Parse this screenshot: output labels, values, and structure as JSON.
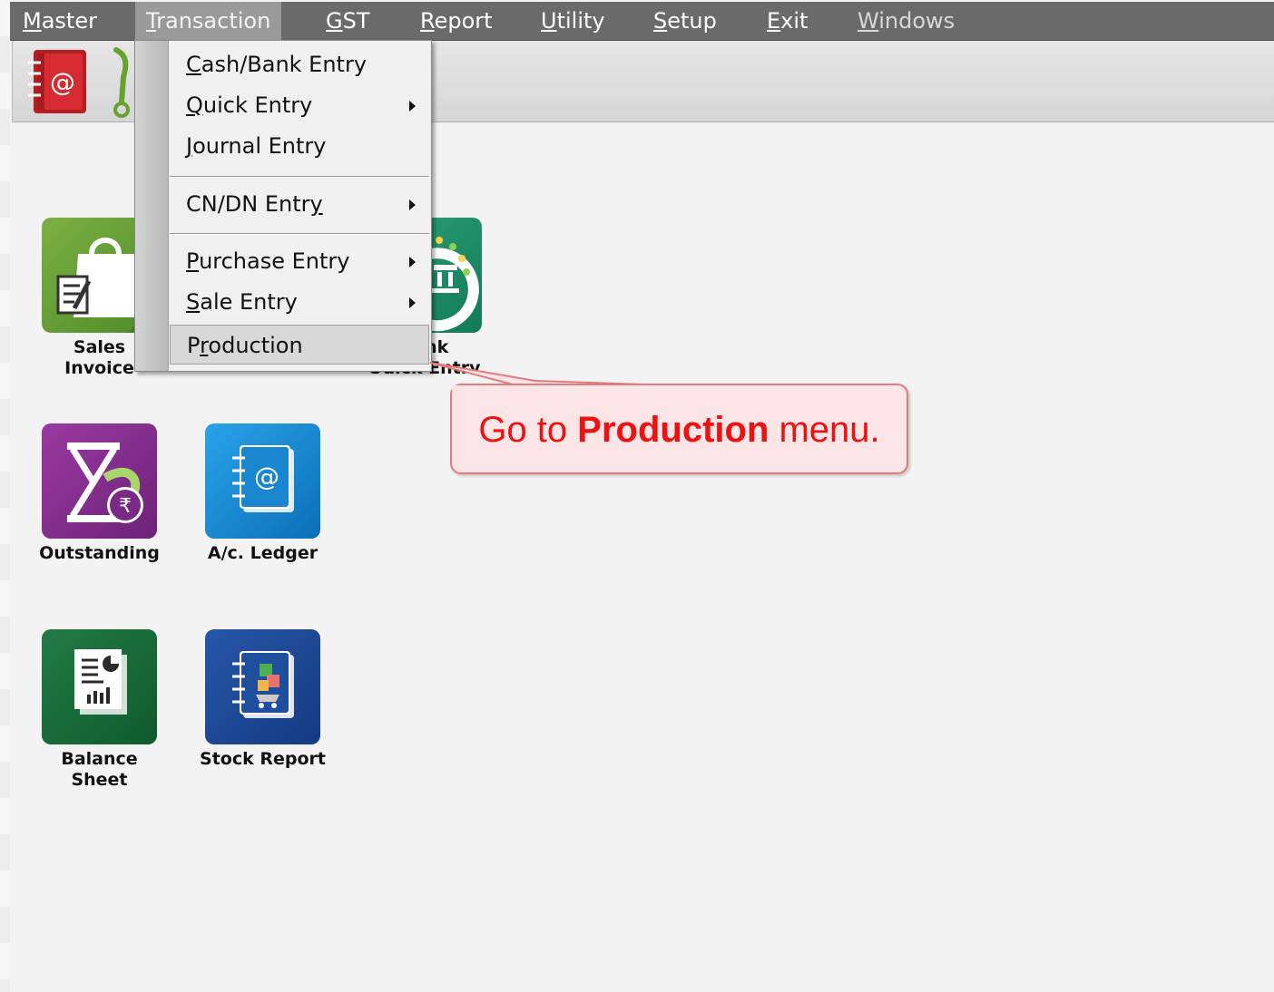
{
  "menubar": {
    "items": [
      {
        "label": "Master",
        "u": "M",
        "rest": "aster"
      },
      {
        "label": "Transaction",
        "u": "T",
        "rest": "ransaction"
      },
      {
        "label": "GST",
        "u": "G",
        "rest": "ST"
      },
      {
        "label": "Report",
        "u": "R",
        "rest": "eport"
      },
      {
        "label": "Utility",
        "u": "U",
        "rest": "tility"
      },
      {
        "label": "Setup",
        "u": "S",
        "rest": "etup"
      },
      {
        "label": "Exit",
        "u": "E",
        "rest": "xit"
      },
      {
        "label": "Windows",
        "u": "W",
        "rest": "indows"
      }
    ],
    "active": "Transaction"
  },
  "dropdown": {
    "items": [
      {
        "pre": "",
        "u": "C",
        "rest": "ash/Bank Entry",
        "submenu": false
      },
      {
        "pre": "",
        "u": "Q",
        "rest": "uick Entry",
        "submenu": true
      },
      {
        "pre": "",
        "u": "J",
        "rest": "ournal Entry",
        "submenu": false
      },
      {
        "pre": "CN/DN Entr",
        "u": "y",
        "rest": "",
        "submenu": true
      },
      {
        "pre": "",
        "u": "P",
        "rest": "urchase Entry",
        "submenu": true
      },
      {
        "pre": "",
        "u": "S",
        "rest": "ale Entry",
        "submenu": true
      },
      {
        "pre": "P",
        "u": "r",
        "rest": "oduction",
        "submenu": false
      }
    ],
    "highlighted": "Production"
  },
  "tiles": {
    "sales_invoice": {
      "line1": "Sales",
      "line2": "Invoice"
    },
    "bank_quick_entry": {
      "line1": "Bank",
      "line2": "Quick Entry"
    },
    "outstanding": {
      "label": "Outstanding"
    },
    "ac_ledger": {
      "label": "A/c. Ledger"
    },
    "balance_sheet": {
      "line1": "Balance",
      "line2": "Sheet"
    },
    "stock_report": {
      "label": "Stock Report"
    }
  },
  "callout": {
    "prefix": "Go to ",
    "bold": "Production",
    "suffix": " menu."
  },
  "colors": {
    "accent": "#ee1111",
    "menubar": "#6a6a6a",
    "callout_bg": "#fbe5e6"
  },
  "icons": [
    "address-book-icon",
    "phone-hook-icon",
    "shopping-bag-icon",
    "bank-icon",
    "hourglass-rupee-icon",
    "ledger-book-icon",
    "balance-sheet-icon",
    "stock-report-icon",
    "submenu-arrow-icon"
  ]
}
